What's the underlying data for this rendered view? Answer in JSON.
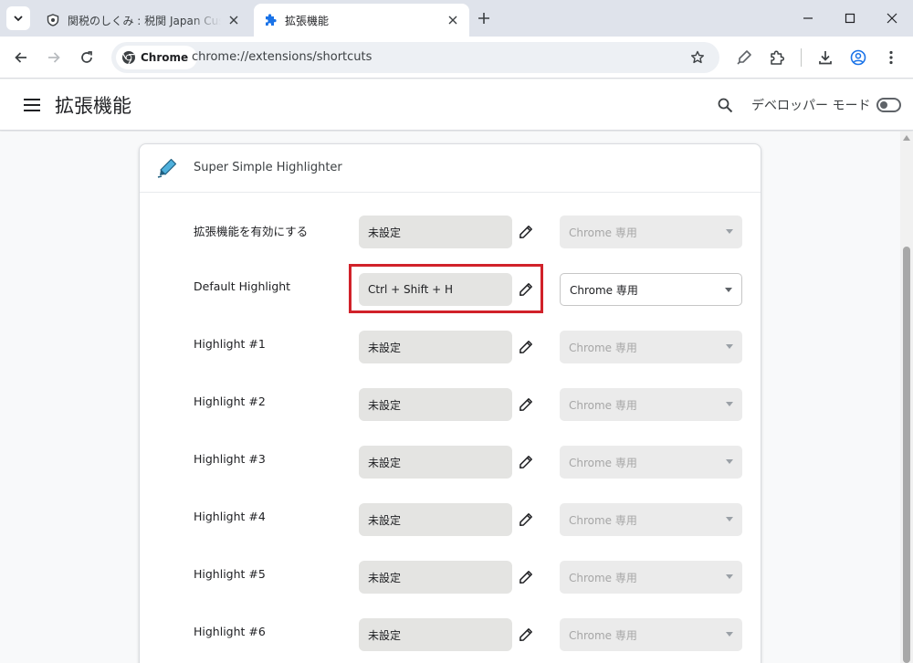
{
  "browser": {
    "tabs": [
      {
        "title": "関税のしくみ : 税関 Japan Customs",
        "active": false
      },
      {
        "title": "拡張機能",
        "active": true
      }
    ],
    "omnibox": {
      "chip_label": "Chrome",
      "url": "chrome://extensions/shortcuts"
    }
  },
  "header": {
    "title": "拡張機能",
    "dev_mode_label": "デベロッパー モード",
    "dev_mode_on": false
  },
  "extension": {
    "name": "Super Simple Highlighter",
    "shortcuts": [
      {
        "label": "拡張機能を有効にする",
        "shortcut": "未設定",
        "scope": "Chrome 専用",
        "scope_enabled": false
      },
      {
        "label": "Default Highlight",
        "shortcut": "Ctrl + Shift + H",
        "scope": "Chrome 専用",
        "scope_enabled": true
      },
      {
        "label": "Highlight #1",
        "shortcut": "未設定",
        "scope": "Chrome 専用",
        "scope_enabled": false
      },
      {
        "label": "Highlight #2",
        "shortcut": "未設定",
        "scope": "Chrome 専用",
        "scope_enabled": false
      },
      {
        "label": "Highlight #3",
        "shortcut": "未設定",
        "scope": "Chrome 専用",
        "scope_enabled": false
      },
      {
        "label": "Highlight #4",
        "shortcut": "未設定",
        "scope": "Chrome 専用",
        "scope_enabled": false
      },
      {
        "label": "Highlight #5",
        "shortcut": "未設定",
        "scope": "Chrome 専用",
        "scope_enabled": false
      },
      {
        "label": "Highlight #6",
        "shortcut": "未設定",
        "scope": "Chrome 専用",
        "scope_enabled": false
      }
    ]
  },
  "annotation": {
    "highlight_color": "#d1222a",
    "highlighted_row": "Default Highlight"
  }
}
